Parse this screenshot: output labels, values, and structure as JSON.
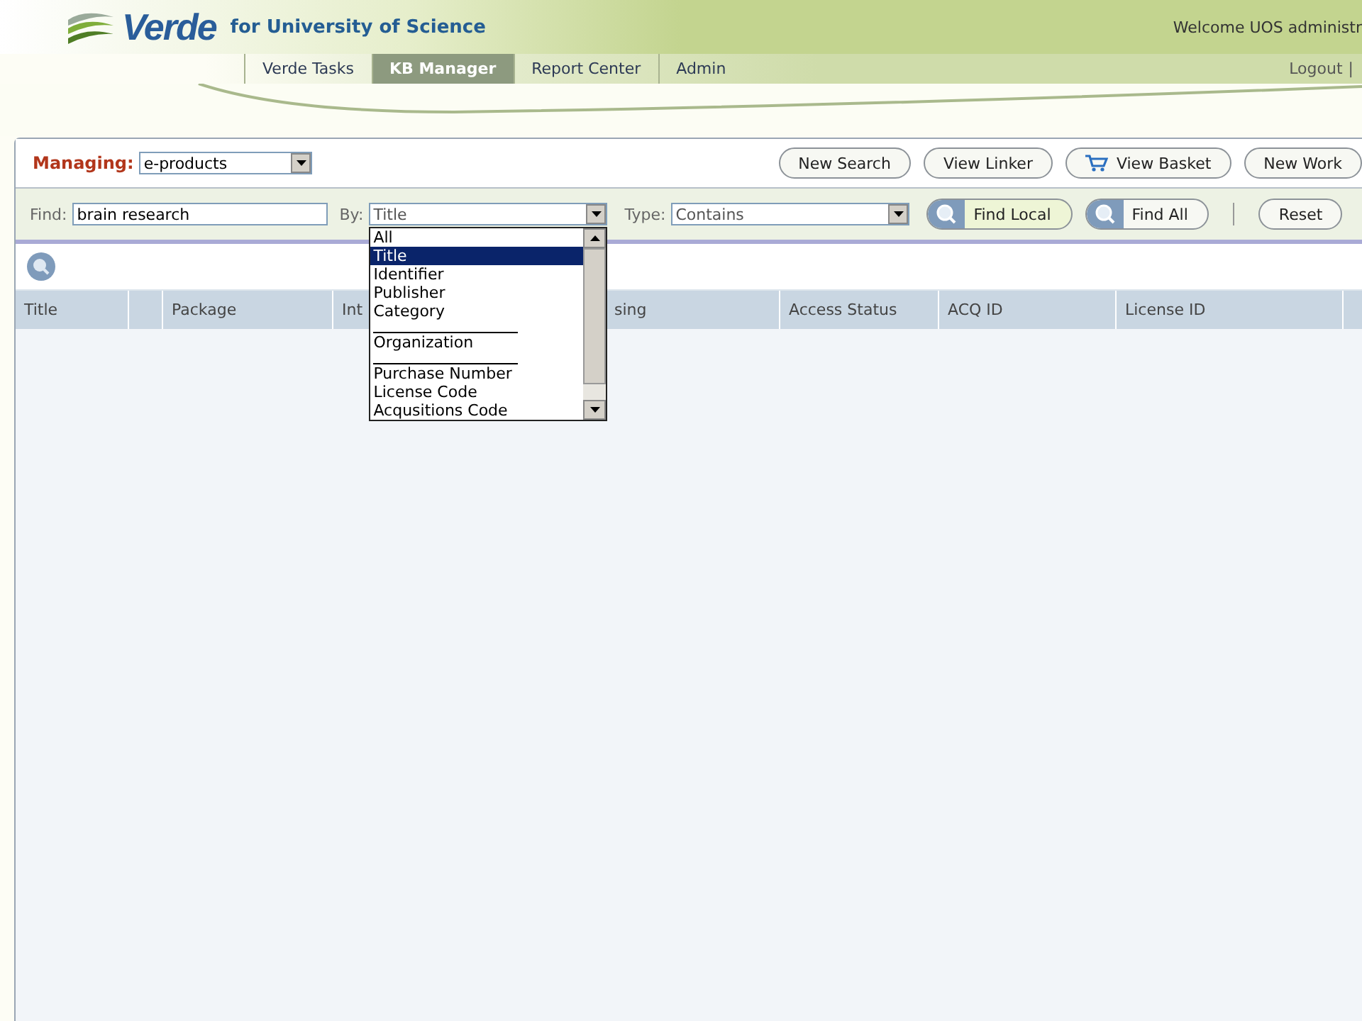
{
  "header": {
    "brand": "Verde",
    "subtitle": "for University of Science",
    "welcome": "Welcome UOS administr",
    "logout": "Logout",
    "logout_separator": "|"
  },
  "nav": [
    {
      "label": "Verde Tasks",
      "selected": false
    },
    {
      "label": "KB Manager",
      "selected": true
    },
    {
      "label": "Report Center",
      "selected": false
    },
    {
      "label": "Admin",
      "selected": false
    }
  ],
  "managing": {
    "label": "Managing:",
    "value": "e-products"
  },
  "actions": [
    {
      "label": "New Search",
      "kind": "plain"
    },
    {
      "label": "View Linker",
      "kind": "plain"
    },
    {
      "label": "View Basket",
      "kind": "cart"
    },
    {
      "label": "New Work",
      "kind": "plain"
    }
  ],
  "search": {
    "find_label": "Find:",
    "find_value": "brain research",
    "by_label": "By:",
    "by_value": "Title",
    "type_label": "Type:",
    "type_value": "Contains"
  },
  "search_buttons": [
    {
      "label": "Find Local",
      "kind": "search",
      "highlighted": true
    },
    {
      "label": "Find All",
      "kind": "search",
      "highlighted": false
    },
    {
      "label": "Reset",
      "kind": "plain",
      "highlighted": false
    }
  ],
  "by_options": [
    {
      "kind": "option",
      "label": "All",
      "selected": false
    },
    {
      "kind": "option",
      "label": "Title",
      "selected": true
    },
    {
      "kind": "option",
      "label": "Identifier",
      "selected": false
    },
    {
      "kind": "option",
      "label": "Publisher",
      "selected": false
    },
    {
      "kind": "option",
      "label": "Category",
      "selected": false
    },
    {
      "kind": "separator"
    },
    {
      "kind": "option",
      "label": "Organization",
      "selected": false
    },
    {
      "kind": "separator"
    },
    {
      "kind": "option",
      "label": "Purchase Number",
      "selected": false
    },
    {
      "kind": "option",
      "label": "License Code",
      "selected": false
    },
    {
      "kind": "option",
      "label": "Acqusitions Code",
      "selected": false
    }
  ],
  "table": {
    "columns": [
      {
        "kind": "text",
        "label": "Title"
      },
      {
        "kind": "blank"
      },
      {
        "kind": "text",
        "label": "Package"
      },
      {
        "kind": "text",
        "label": "Int"
      },
      {
        "kind": "covered",
        "label": "sing"
      },
      {
        "kind": "text",
        "label": "Access Status"
      },
      {
        "kind": "text",
        "label": "ACQ ID"
      },
      {
        "kind": "text",
        "label": "License ID"
      },
      {
        "kind": "blank"
      }
    ]
  }
}
